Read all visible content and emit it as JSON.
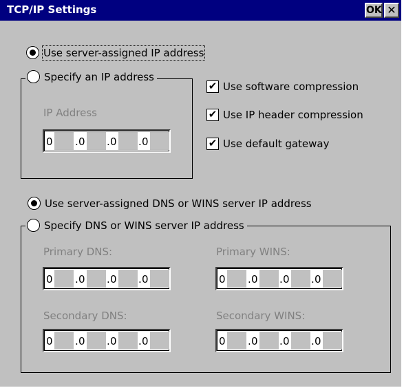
{
  "window": {
    "title": "TCP/IP Settings",
    "ok_label": "OK",
    "close_label": "✕"
  },
  "ip_mode": {
    "server_assigned_label": "Use server-assigned IP address",
    "specify_label": "Specify an IP address",
    "selected": "server_assigned"
  },
  "ip_address": {
    "label": "IP Address",
    "octets": [
      "0",
      "0",
      "0",
      "0"
    ]
  },
  "options": [
    {
      "label": "Use software compression",
      "checked": true
    },
    {
      "label": "Use IP header compression",
      "checked": true
    },
    {
      "label": "Use default gateway",
      "checked": true
    }
  ],
  "dns_mode": {
    "server_assigned_label": "Use server-assigned DNS or WINS server IP address",
    "specify_label": "Specify DNS or WINS server IP address",
    "selected": "server_assigned"
  },
  "dns_fields": {
    "primary_dns": {
      "label": "Primary DNS:",
      "octets": [
        "0",
        "0",
        "0",
        "0"
      ]
    },
    "primary_wins": {
      "label": "Primary WINS:",
      "octets": [
        "0",
        "0",
        "0",
        "0"
      ]
    },
    "secondary_dns": {
      "label": "Secondary DNS:",
      "octets": [
        "0",
        "0",
        "0",
        "0"
      ]
    },
    "secondary_wins": {
      "label": "Secondary WINS:",
      "octets": [
        "0",
        "0",
        "0",
        "0"
      ]
    }
  },
  "check_glyph": "✔",
  "colors": {
    "titlebar": "#000080",
    "face": "#c0c0c0",
    "disabled_text": "#808080"
  }
}
